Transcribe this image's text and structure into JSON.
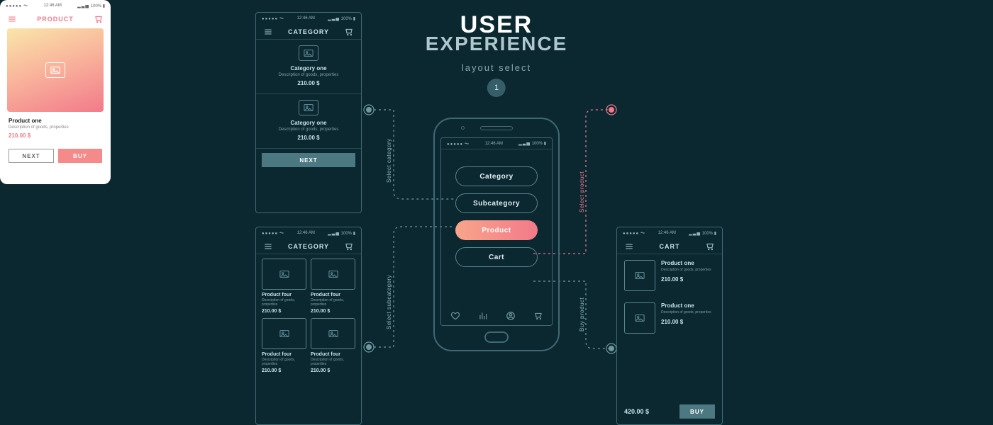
{
  "heading": {
    "line1": "USER",
    "line2": "EXPERIENCE",
    "sub": "layout select",
    "badge": "1"
  },
  "status": {
    "time": "12:46 AM",
    "battery": "100%"
  },
  "centerPhone": {
    "pills": [
      "Category",
      "Subcategory",
      "Product",
      "Cart"
    ],
    "activeIndex": 2
  },
  "connectors": {
    "cat": "Select category",
    "sub": "Select subcategory",
    "prod": "Select product",
    "buy": "Buy product"
  },
  "s1": {
    "title": "CATEGORY",
    "items": [
      {
        "name": "Category one",
        "desc": "Description of goods, properties",
        "price": "210.00 $"
      },
      {
        "name": "Category one",
        "desc": "Description of goods, properties",
        "price": "210.00 $"
      }
    ],
    "nextLabel": "NEXT"
  },
  "s2": {
    "title": "CATEGORY",
    "items": [
      {
        "name": "Product four",
        "desc": "Description of goods, properties",
        "price": "210.00 $"
      },
      {
        "name": "Product four",
        "desc": "Description of goods, properties",
        "price": "210.00 $"
      },
      {
        "name": "Product four",
        "desc": "Description of goods, properties",
        "price": "210.00 $"
      },
      {
        "name": "Product four",
        "desc": "Description of goods, properties",
        "price": "210.00 $"
      }
    ]
  },
  "s3": {
    "title": "PRODUCT",
    "name": "Product one",
    "desc": "Description of goods, properties",
    "price": "210.00 $",
    "nextLabel": "NEXT",
    "buyLabel": "BUY"
  },
  "s4": {
    "title": "CART",
    "items": [
      {
        "name": "Product one",
        "desc": "Description of goods, properties",
        "price": "210.00 $"
      },
      {
        "name": "Product one",
        "desc": "Description of goods, properties",
        "price": "210.00 $"
      }
    ],
    "total": "420.00 $",
    "buyLabel": "BUY"
  }
}
